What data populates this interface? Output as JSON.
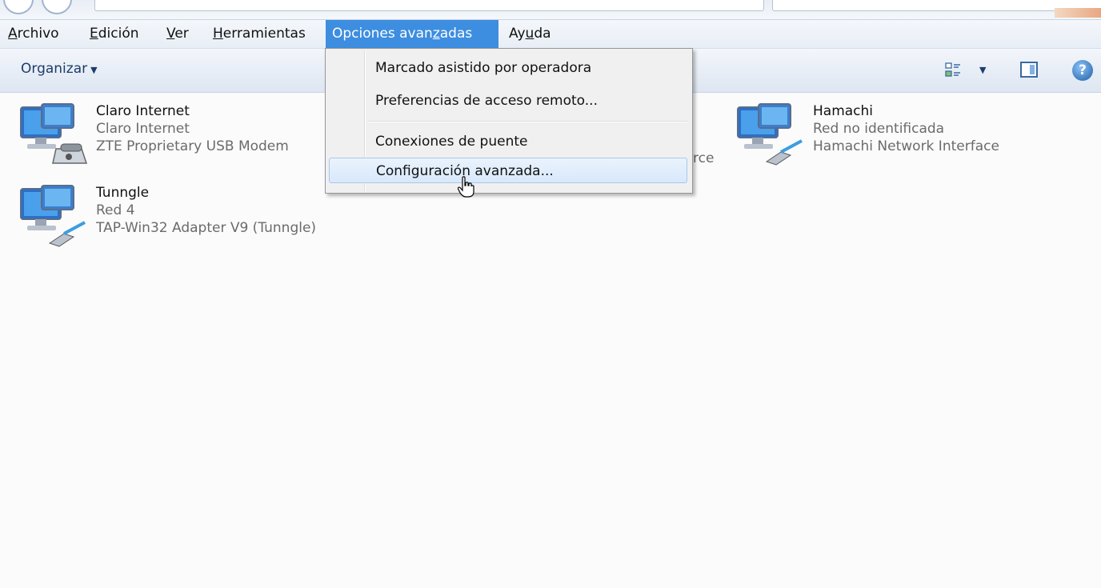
{
  "menubar": {
    "items": [
      {
        "label": "Archivo"
      },
      {
        "label": "Edición"
      },
      {
        "label": "Ver"
      },
      {
        "label": "Herramientas"
      },
      {
        "label": "Opciones avanzadas",
        "active": true
      },
      {
        "label": "Ayuda"
      }
    ]
  },
  "commandbar": {
    "organize_label": "Organizar",
    "icons": [
      "change-view-icon",
      "preview-pane-icon",
      "help-icon"
    ]
  },
  "connections": [
    {
      "name": "Claro Internet",
      "status": "Claro Internet",
      "device": "ZTE Proprietary USB Modem",
      "icon": "dialup-modem-icon"
    },
    {
      "name": "Tunngle",
      "status": "Red 4",
      "device": "TAP-Win32 Adapter V9 (Tunngle)",
      "icon": "network-cable-icon"
    },
    {
      "name": "Hamachi",
      "status": "Red no identificada",
      "device": "Hamachi Network Interface",
      "icon": "network-cable-icon"
    }
  ],
  "partial_text": "rce",
  "dropdown": {
    "items": [
      {
        "label": "Marcado asistido por operadora"
      },
      {
        "label": "Preferencias de acceso remoto..."
      },
      {
        "label": "Conexiones de puente"
      },
      {
        "label": "Configuración avanzada...",
        "highlighted": true
      }
    ]
  },
  "colors": {
    "menu_active": "#3d8ee0",
    "hover_fill": "#d8e8fb",
    "status_text": "#6b6b6b"
  }
}
